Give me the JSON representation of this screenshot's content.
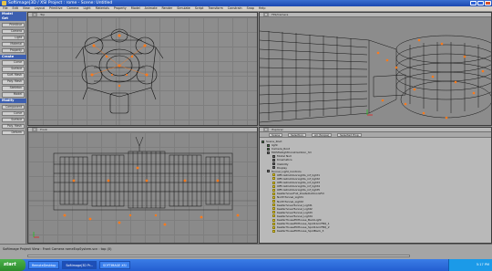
{
  "window": {
    "title": "Softimage|3D / XSI Project : rome - Scene: Untitled"
  },
  "menu": [
    "File",
    "Edit",
    "View",
    "Layout",
    "Primitive",
    "Camera",
    "Light",
    "Materials",
    "Property",
    "Model",
    "Animate",
    "Render",
    "Simulate",
    "Script",
    "Transform",
    "Constrain",
    "Snap",
    "Help"
  ],
  "left_panel": {
    "sections": [
      {
        "title": "Model",
        "color": "#3d5fb0",
        "buttons": []
      },
      {
        "title": "Get",
        "color": "#3d5fb0",
        "buttons": [
          "Primitive",
          "Camera",
          "Light",
          "Material",
          "Property"
        ]
      },
      {
        "title": "Create",
        "color": "#3d5fb0",
        "buttons": [
          "Curve",
          "Surface",
          "Surf. Mesh",
          "Poly. Mesh",
          "Skeleton",
          "Model"
        ]
      },
      {
        "title": "Modify",
        "color": "#3d5fb0",
        "buttons": [
          "Component",
          "Curve",
          "Surface",
          "Poly. Mesh",
          "Deform"
        ]
      }
    ]
  },
  "viewports": {
    "top_left": {
      "tag": "A",
      "label": "Top",
      "sub": "Wireframe"
    },
    "top_right": {
      "tag": "B",
      "label": "FP2/Camera",
      "sub": "Wireframe"
    },
    "bottom_left": {
      "tag": "C",
      "label": "Front",
      "sub": "Wireframe"
    },
    "bottom_right": {
      "tag": "D",
      "label": "Explorer",
      "sub": ""
    }
  },
  "explorer": {
    "toolbar": [
      "Scene",
      "Selection",
      "All (Scope)",
      "Selected Prop"
    ],
    "tree": [
      {
        "label": "Scene_Root",
        "indent": 0,
        "icon": "g"
      },
      {
        "label": "light",
        "indent": 1,
        "icon": "g"
      },
      {
        "label": "Camera_Root",
        "indent": 1,
        "icon": "g"
      },
      {
        "label": "MOSTwilightConstraintion_3d",
        "indent": 1,
        "icon": "n"
      },
      {
        "label": "Model Null",
        "indent": 2,
        "icon": "n"
      },
      {
        "label": "Kinematics",
        "indent": 2,
        "icon": "n"
      },
      {
        "label": "Visibility",
        "indent": 2,
        "icon": "n"
      },
      {
        "label": "Display",
        "indent": 2,
        "icon": "n"
      },
      {
        "label": "Tunnel_Light_Controls",
        "indent": 1,
        "icon": "n"
      },
      {
        "label": "OfficialOutdoorLights_inf_light1",
        "indent": 2,
        "icon": "y"
      },
      {
        "label": "OfficialOutdoorLights_inf_light2",
        "indent": 2,
        "icon": "y"
      },
      {
        "label": "OfficialOutdoorLights_inf_light3",
        "indent": 2,
        "icon": "y"
      },
      {
        "label": "OfficialOutdoorLights_inf_light4",
        "indent": 2,
        "icon": "y"
      },
      {
        "label": "OfficialOutdoorLights_inf_light5",
        "indent": 2,
        "icon": "y"
      },
      {
        "label": "KeaferhoverFull_kGateOutdoorsFill",
        "indent": 2,
        "icon": "y"
      },
      {
        "label": "NorthTunnel_Light1",
        "indent": 2,
        "icon": "y"
      },
      {
        "label": "NorthTunnel_Light2",
        "indent": 2,
        "icon": "y"
      },
      {
        "label": "KeaferhoverTunnel_Light1",
        "indent": 2,
        "icon": "y"
      },
      {
        "label": "KeaferhoverTunnel_Light2",
        "indent": 2,
        "icon": "y"
      },
      {
        "label": "KeaferhoverTunnel_Light3",
        "indent": 2,
        "icon": "y"
      },
      {
        "label": "KeaferhoverTunnel_Light4",
        "indent": 2,
        "icon": "y"
      },
      {
        "label": "KeaferHouseFillHouse_BackLight",
        "indent": 2,
        "icon": "y"
      },
      {
        "label": "KeaferHouseFillHouse_Spot1GrnFBQ_1",
        "indent": 2,
        "icon": "y"
      },
      {
        "label": "KeaferHouseFillHouse_Spot1GrnFBQ_2",
        "indent": 2,
        "icon": "y"
      },
      {
        "label": "KeaferHouseFillHouse_SpotBack_3",
        "indent": 2,
        "icon": "y"
      }
    ]
  },
  "status": {
    "text": "Softimage Project View : Front Camera romeExpSystem.scn : top (0)"
  },
  "taskbar": {
    "start": "start",
    "tasks": [
      {
        "label": "RemoteDesktop",
        "active": false
      },
      {
        "label": "Softimage|3D Pr...",
        "active": true
      },
      {
        "label": "SOFTIMAGE XSI",
        "active": false
      }
    ],
    "clock": "5:17 PM"
  },
  "colors": {
    "accent_orange": "#ff7a1a",
    "viewport_bg": "#8c8c8c",
    "explorer_bg": "#b9b9b9",
    "taskbar_blue": "#245ed1"
  }
}
